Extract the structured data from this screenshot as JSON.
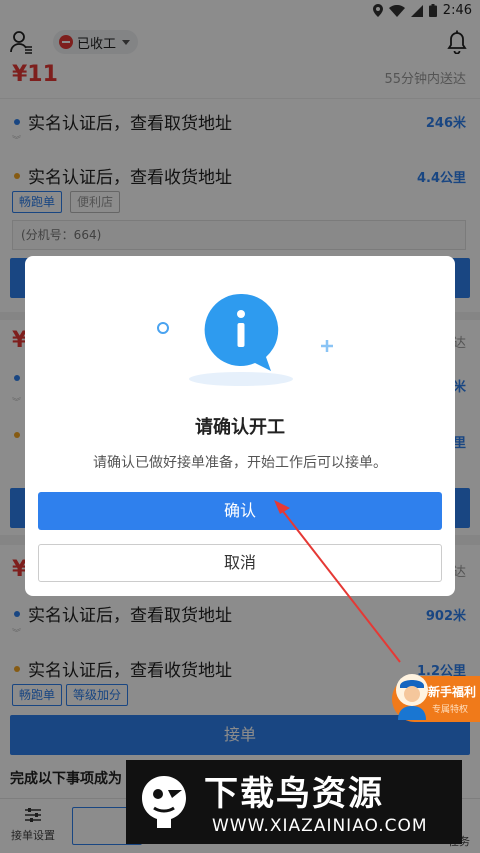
{
  "statusbar": {
    "time": "2:46"
  },
  "topbar": {
    "status_label": "已收工"
  },
  "orders": [
    {
      "price": "¥11",
      "deadline": "55分钟内送达",
      "pickup": "实名认证后，查看取货地址",
      "pickup_distance": "246米",
      "delivery": "实名认证后，查看收货地址",
      "delivery_distance": "4.4公里",
      "tags": [
        "畅跑单",
        "便利店"
      ],
      "extension": "(分机号：664)"
    },
    {
      "price": "¥1",
      "deadline": "达",
      "pickup_distance": "米",
      "delivery_distance": "里"
    },
    {
      "price": "¥",
      "deadline": "达",
      "pickup": "实名认证后，查看取货地址",
      "pickup_distance": "902米",
      "delivery": "实名认证后，查看收货地址",
      "delivery_distance": "1.2公里",
      "tags": [
        "畅跑单",
        "等级加分"
      ],
      "accept": "接单"
    }
  ],
  "notice": "完成以下事项成为",
  "bottom": {
    "settings": "接单设置",
    "tasks": "任务"
  },
  "promo": {
    "title": "新手福利",
    "subtitle": "专属特权"
  },
  "dialog": {
    "title": "请确认开工",
    "message": "请确认已做好接单准备，开始工作后可以接单。",
    "confirm": "确认",
    "cancel": "取消"
  },
  "watermark": {
    "title": "下载鸟资源",
    "url": "WWW.XIAZAINIAO.COM"
  },
  "colors": {
    "primary": "#2f80ed",
    "price": "#e53935",
    "promo": "#f07a1a"
  }
}
